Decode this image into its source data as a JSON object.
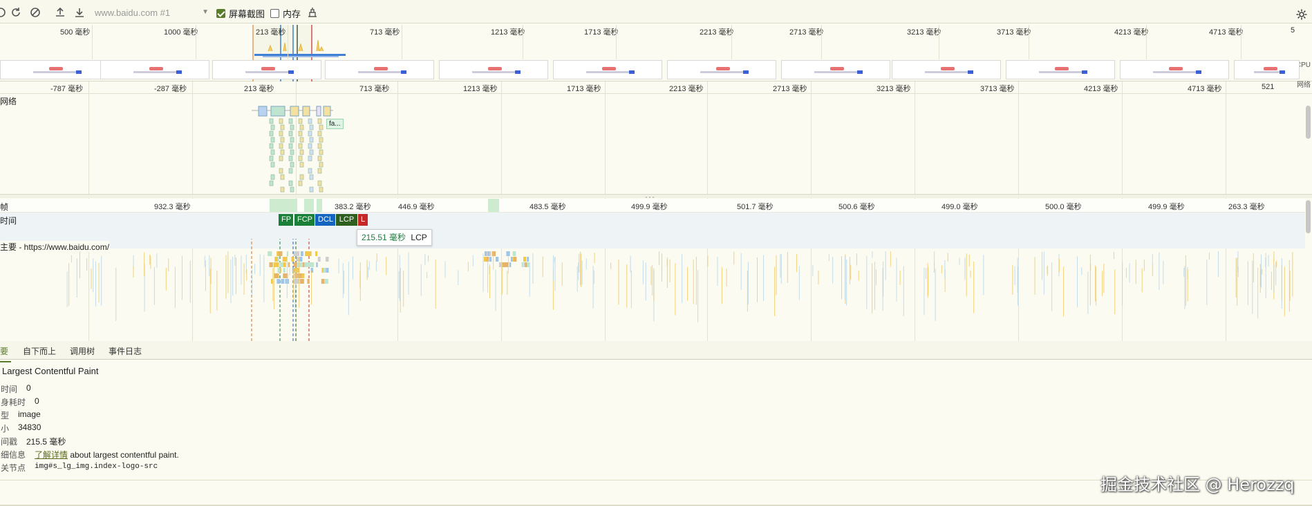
{
  "toolbar": {
    "url_placeholder": "www.baidu.com #1",
    "screenshots_label": "屏幕截图",
    "screenshots_checked": true,
    "memory_label": "内存",
    "memory_checked": false
  },
  "overview": {
    "ticks": [
      "500 毫秒",
      "1000 毫秒",
      "213 毫秒",
      "713 毫秒",
      "1213 毫秒",
      "1713 毫秒",
      "2213 毫秒",
      "2713 毫秒",
      "3213 毫秒",
      "3713 毫秒",
      "4213 毫秒",
      "4713 毫秒",
      "5"
    ],
    "cpu_label": "CPU",
    "network_label": "网络"
  },
  "main_ruler": {
    "ticks": [
      "-787 毫秒",
      "-287 毫秒",
      "213 毫秒",
      "713 毫秒",
      "1213 毫秒",
      "1713 毫秒",
      "2213 毫秒",
      "2713 毫秒",
      "3213 毫秒",
      "3713 毫秒",
      "4213 毫秒",
      "4713 毫秒",
      "521"
    ]
  },
  "tracks": {
    "network": "网络",
    "frames": "帧",
    "timings": "时间",
    "main": "主要 - https://www.baidu.com/",
    "net_item_label": "fa..."
  },
  "frames_row": [
    "932.3 毫秒",
    "383.2 毫秒",
    "446.9 毫秒",
    "483.5 毫秒",
    "499.9 毫秒",
    "501.7 毫秒",
    "500.6 毫秒",
    "499.0 毫秒",
    "500.0 毫秒",
    "499.9 毫秒",
    "263.3 毫秒"
  ],
  "markers": [
    {
      "label": "FP",
      "color": "#1a7f37"
    },
    {
      "label": "FCP",
      "color": "#1a7f37"
    },
    {
      "label": "DCL",
      "color": "#1565c0"
    },
    {
      "label": "LCP",
      "color": "#2f5f1e"
    },
    {
      "label": "L",
      "color": "#c62828"
    }
  ],
  "tooltip": {
    "duration": "215.51 毫秒",
    "name": "LCP"
  },
  "tabs": [
    "要",
    "自下而上",
    "调用树",
    "事件日志"
  ],
  "summary": {
    "title": "Largest Contentful Paint",
    "rows": [
      {
        "key": "时间",
        "value": "0"
      },
      {
        "key": "身耗时",
        "value": "0"
      },
      {
        "key": "型",
        "value": "image"
      },
      {
        "key": "小",
        "value": "34830"
      },
      {
        "key": "间戳",
        "value": "215.5 毫秒"
      }
    ],
    "details_key": "细信息",
    "details_link": "了解详情",
    "details_text": "about largest contentful paint.",
    "node_key": "关节点",
    "node_value": "img#s_lg_img.index-logo-src"
  },
  "watermark": "掘金技术社区 @ Herozzq"
}
